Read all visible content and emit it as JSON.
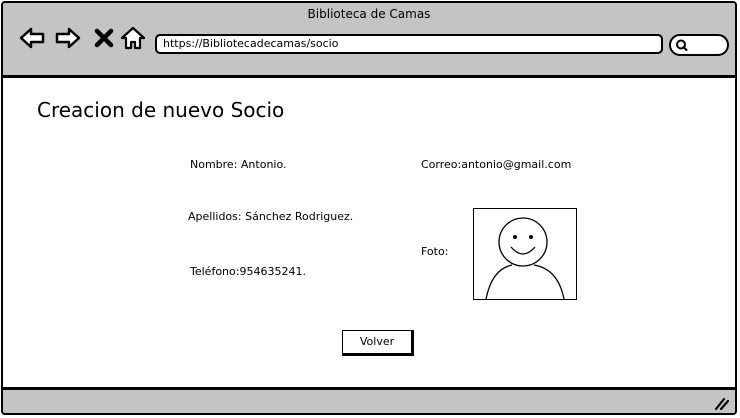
{
  "window": {
    "title": "Biblioteca de Camas"
  },
  "browser": {
    "url": "https://Bibliotecadecamas/socio",
    "icons": [
      "back-arrow-icon",
      "forward-arrow-icon",
      "close-icon",
      "home-icon",
      "search-icon"
    ]
  },
  "page": {
    "title": "Creacion de nuevo Socio",
    "nombre": "Nombre: Antonio.",
    "apellidos": "Apellidos: Sánchez Rodriguez.",
    "telefono": "Teléfono:954635241.",
    "correo": "Correo:antonio@gmail.com",
    "foto_label": "Foto:",
    "back_label": "Volver"
  },
  "colors": {
    "chrome": "#c4c4c4",
    "border": "#000000",
    "background": "#ffffff"
  }
}
